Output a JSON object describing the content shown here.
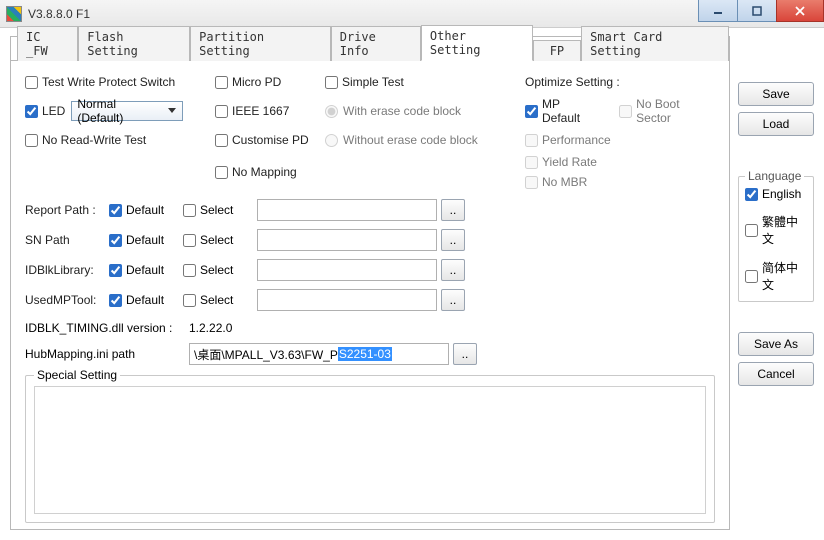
{
  "window": {
    "title": "V3.8.8.0 F1"
  },
  "tabs": [
    {
      "label": "IC _FW"
    },
    {
      "label": "Flash Setting"
    },
    {
      "label": "Partition Setting"
    },
    {
      "label": "Drive Info"
    },
    {
      "label": "Other Setting"
    },
    {
      "label": "FP"
    },
    {
      "label": "Smart Card Setting"
    }
  ],
  "active_tab": 4,
  "col1": {
    "test_write_protect": {
      "label": "Test Write Protect Switch",
      "checked": false
    },
    "led": {
      "label": "LED",
      "checked": true,
      "dropdown": "Normal (Default)"
    },
    "no_rw_test": {
      "label": "No Read-Write Test",
      "checked": false
    }
  },
  "col2": {
    "micro_pd": {
      "label": "Micro PD",
      "checked": false
    },
    "ieee1667": {
      "label": "IEEE 1667",
      "checked": false
    },
    "customise_pd": {
      "label": "Customise PD",
      "checked": false
    },
    "no_mapping": {
      "label": "No Mapping",
      "checked": false
    }
  },
  "col3": {
    "simple_test": {
      "label": "Simple Test",
      "checked": false
    },
    "radio_with": "With erase code block",
    "radio_without": "Without erase code block"
  },
  "optimize": {
    "header": "Optimize Setting :",
    "mp_default": {
      "label": "MP Default",
      "checked": true
    },
    "no_boot": {
      "label": "No Boot Sector",
      "checked": false
    },
    "performance": {
      "label": "Performance",
      "checked": false
    },
    "yield_rate": {
      "label": "Yield Rate",
      "checked": false
    },
    "no_mbr": {
      "label": "No MBR",
      "checked": false
    }
  },
  "paths": {
    "rows": [
      {
        "label": "Report Path :",
        "default_checked": true,
        "select_checked": false,
        "value": ""
      },
      {
        "label": "SN Path",
        "default_checked": true,
        "select_checked": false,
        "value": ""
      },
      {
        "label": "IDBlkLibrary:",
        "default_checked": true,
        "select_checked": false,
        "value": ""
      },
      {
        "label": "UsedMPTool:",
        "default_checked": true,
        "select_checked": false,
        "value": ""
      }
    ],
    "default_label": "Default",
    "select_label": "Select",
    "browse_label": ".."
  },
  "version": {
    "label": "IDBLK_TIMING.dll version :",
    "value": "1.2.22.0"
  },
  "hubmapping": {
    "label": "HubMapping.ini path",
    "prefix": "\\桌面\\MPALL_V3.63\\FW_P",
    "selected": "S2251-03",
    "browse": ".."
  },
  "special": {
    "legend": "Special Setting",
    "content": ""
  },
  "buttons": {
    "save": "Save",
    "load": "Load",
    "save_as": "Save As",
    "cancel": "Cancel"
  },
  "language": {
    "legend": "Language",
    "english": {
      "label": "English",
      "checked": true
    },
    "traditional": {
      "label": "繁體中文",
      "checked": false
    },
    "simplified": {
      "label": "简体中文",
      "checked": false
    }
  }
}
